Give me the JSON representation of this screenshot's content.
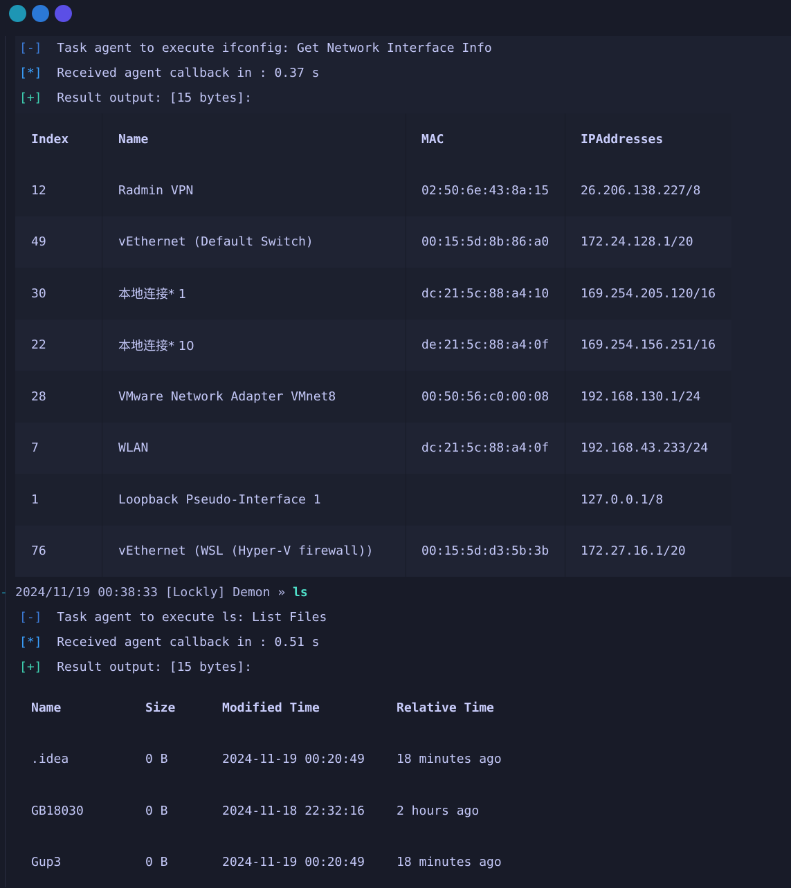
{
  "window": {
    "dot_colors": [
      "#1e96b4",
      "#2b78d6",
      "#5b4fe6"
    ]
  },
  "block1": {
    "tag1": "[-]",
    "msg1": "Task agent to execute ifconfig: Get Network Interface Info",
    "tag2": "[*]",
    "msg2": "Received agent callback in : 0.37 s",
    "tag3": "[+]",
    "msg3": "Result output: [15 bytes]:",
    "columns": [
      "Index",
      "Name",
      "MAC",
      "IPAddresses"
    ],
    "rows": [
      [
        "12",
        "Radmin VPN",
        "02:50:6e:43:8a:15",
        "26.206.138.227/8"
      ],
      [
        "49",
        "vEthernet (Default Switch)",
        "00:15:5d:8b:86:a0",
        "172.24.128.1/20"
      ],
      [
        "30",
        "本地连接* 1",
        "dc:21:5c:88:a4:10",
        "169.254.205.120/16"
      ],
      [
        "22",
        "本地连接* 10",
        "de:21:5c:88:a4:0f",
        "169.254.156.251/16"
      ],
      [
        "28",
        "VMware Network Adapter VMnet8",
        "00:50:56:c0:00:08",
        "192.168.130.1/24"
      ],
      [
        "7",
        "WLAN",
        "dc:21:5c:88:a4:0f",
        "192.168.43.233/24"
      ],
      [
        "1",
        "Loopback Pseudo-Interface 1",
        "",
        "127.0.0.1/8"
      ],
      [
        "76",
        "vEthernet (WSL (Hyper-V firewall))",
        "00:15:5d:d3:5b:3b",
        "172.27.16.1/20"
      ]
    ]
  },
  "prompt": {
    "timestamp": "2024/11/19 00:38:33",
    "context": "[Lockly] Demon",
    "arrow": "»",
    "command": "ls"
  },
  "block2": {
    "tag1": "[-]",
    "msg1": "Task agent to execute ls: List Files",
    "tag2": "[*]",
    "msg2": "Received agent callback in : 0.51 s",
    "tag3": "[+]",
    "msg3": "Result output: [15 bytes]:",
    "columns": [
      "Name",
      "Size",
      "Modified Time",
      "Relative Time"
    ],
    "rows": [
      [
        ".idea",
        "0 B",
        "2024-11-19 00:20:49",
        "18 minutes ago"
      ],
      [
        "GB18030",
        "0 B",
        "2024-11-18 22:32:16",
        "2 hours ago"
      ],
      [
        "Gup3",
        "0 B",
        "2024-11-19 00:20:49",
        "18 minutes ago"
      ]
    ]
  }
}
